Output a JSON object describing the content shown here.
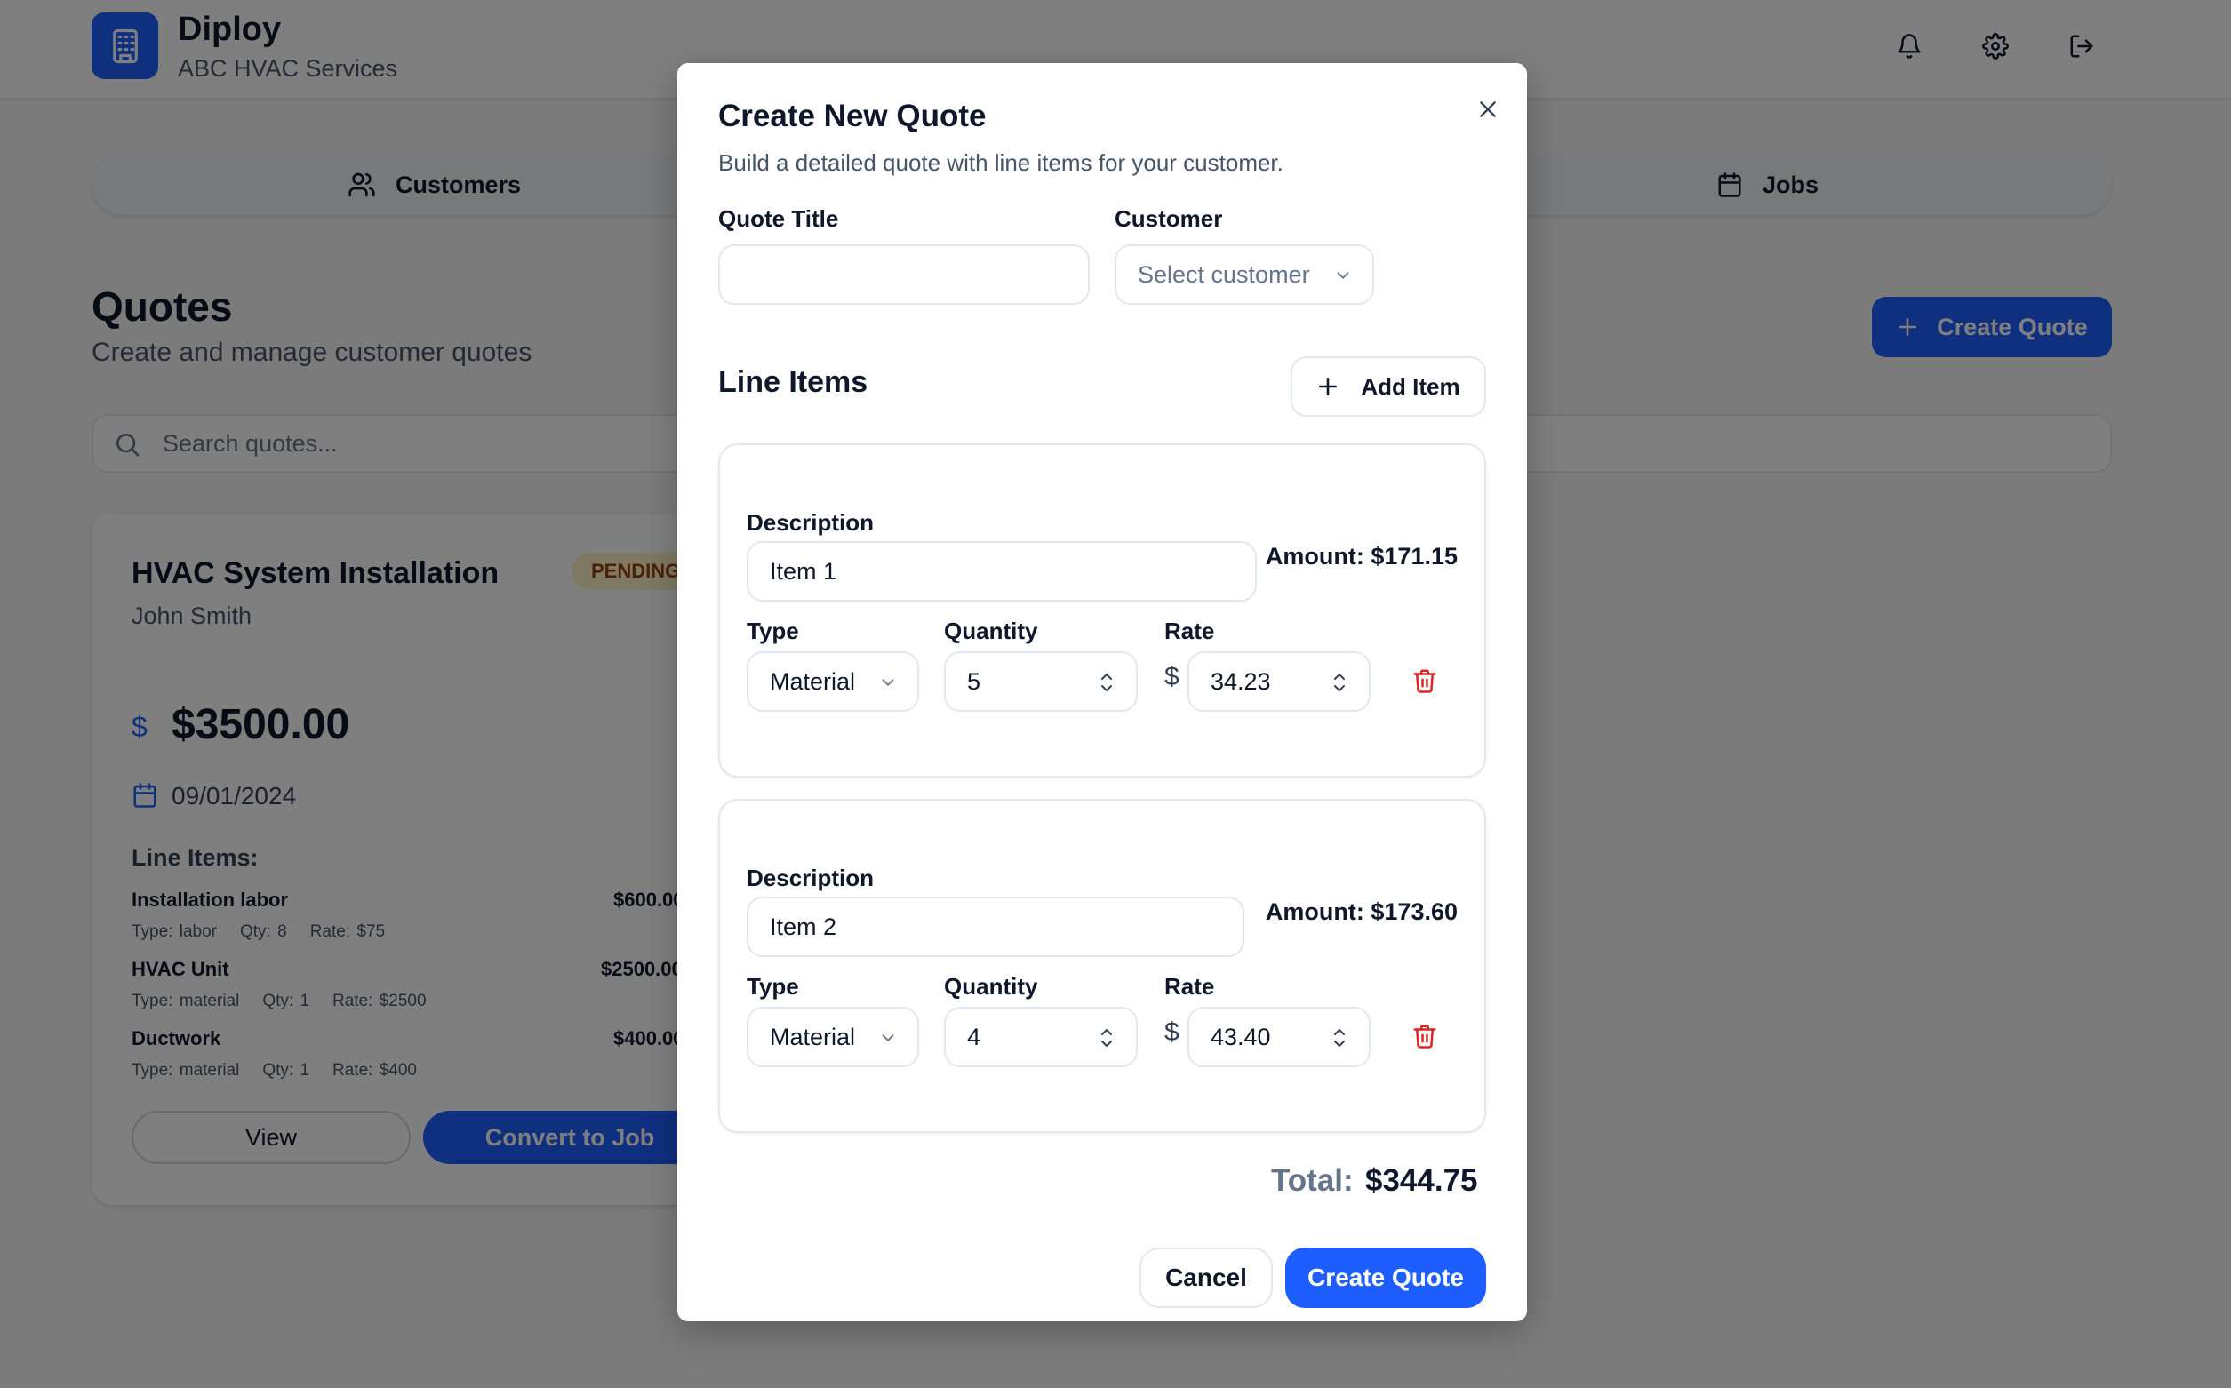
{
  "app": {
    "name": "Diploy",
    "company": "ABC HVAC Services",
    "icons": [
      "building-icon",
      "bell-icon",
      "gear-icon",
      "logout-icon"
    ]
  },
  "nav": {
    "tabs": [
      {
        "label": "Customers",
        "icon": "users-icon"
      },
      {
        "label": "Jobs",
        "icon": "calendar-icon"
      }
    ]
  },
  "page": {
    "title": "Quotes",
    "subtitle": "Create and manage customer quotes",
    "create_button": "Create Quote",
    "search_placeholder": "Search quotes..."
  },
  "quote_card": {
    "title": "HVAC System Installation",
    "status": "PENDING",
    "customer": "John Smith",
    "amount": "$3500.00",
    "date": "09/01/2024",
    "line_items_heading": "Line Items:",
    "items": [
      {
        "name": "Installation labor",
        "amount": "$600.00",
        "type": "Type: labor",
        "qty": "Qty: 8",
        "rate": "Rate: $75"
      },
      {
        "name": "HVAC Unit",
        "amount": "$2500.00",
        "type": "Type: material",
        "qty": "Qty: 1",
        "rate": "Rate: $2500"
      },
      {
        "name": "Ductwork",
        "amount": "$400.00",
        "type": "Type: material",
        "qty": "Qty: 1",
        "rate": "Rate: $400"
      }
    ],
    "view_button": "View",
    "convert_button": "Convert to Job"
  },
  "modal": {
    "title": "Create New Quote",
    "subtitle": "Build a detailed quote with line items for your customer.",
    "quote_title_label": "Quote Title",
    "quote_title_value": "",
    "customer_label": "Customer",
    "customer_placeholder": "Select customer",
    "line_items_title": "Line Items",
    "add_item_button": "Add Item",
    "description_label": "Description",
    "type_label": "Type",
    "quantity_label": "Quantity",
    "rate_label": "Rate",
    "currency_symbol": "$",
    "items": [
      {
        "description": "Item 1",
        "amount": "Amount: $171.15",
        "type": "Material",
        "quantity": "5",
        "rate": "34.23"
      },
      {
        "description": "Item 2",
        "amount": "Amount: $173.60",
        "type": "Material",
        "quantity": "4",
        "rate": "43.40"
      }
    ],
    "total_label": "Total:",
    "total_value": "$344.75",
    "cancel_button": "Cancel",
    "submit_button": "Create Quote"
  },
  "colors": {
    "accent": "#1e5eff",
    "danger": "#dc2626",
    "pending_badge_bg": "#fef3c7",
    "overlay": "rgba(0,0,0,0.5)"
  }
}
